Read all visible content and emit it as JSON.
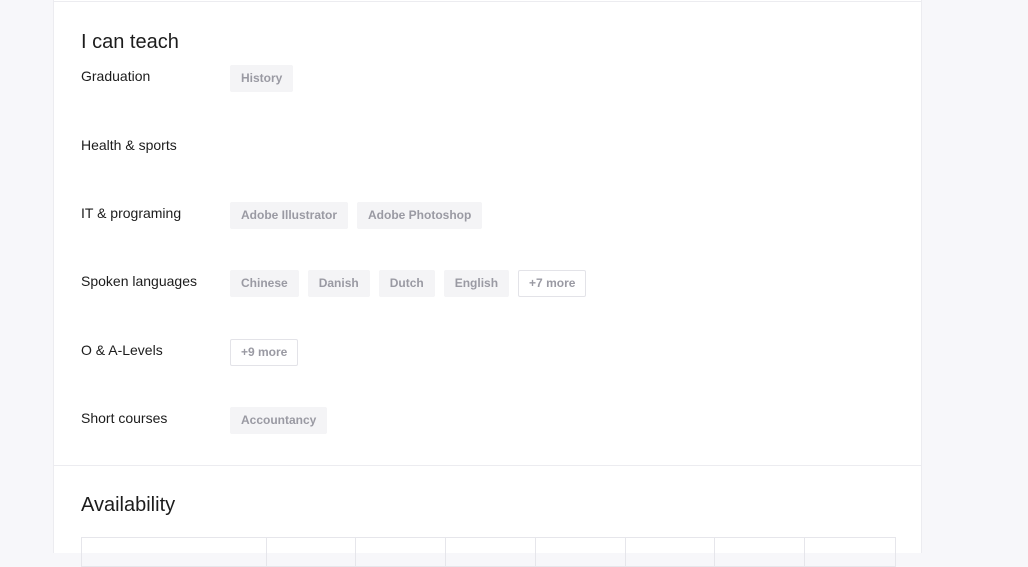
{
  "teach": {
    "title": "I can teach",
    "rows": [
      {
        "label": "Graduation",
        "tags": [
          "History"
        ]
      },
      {
        "label": "Health & sports",
        "tags": []
      },
      {
        "label": "IT & programing",
        "tags": [
          "Adobe Illustrator",
          "Adobe Photoshop"
        ]
      },
      {
        "label": "Spoken languages",
        "tags": [
          "Chinese",
          "Danish",
          "Dutch",
          "English"
        ],
        "more": "+7 more"
      },
      {
        "label": "O & A-Levels",
        "tags": [],
        "more": "+9 more"
      },
      {
        "label": "Short courses",
        "tags": [
          "Accountancy"
        ]
      }
    ]
  },
  "availability": {
    "title": "Availability"
  }
}
